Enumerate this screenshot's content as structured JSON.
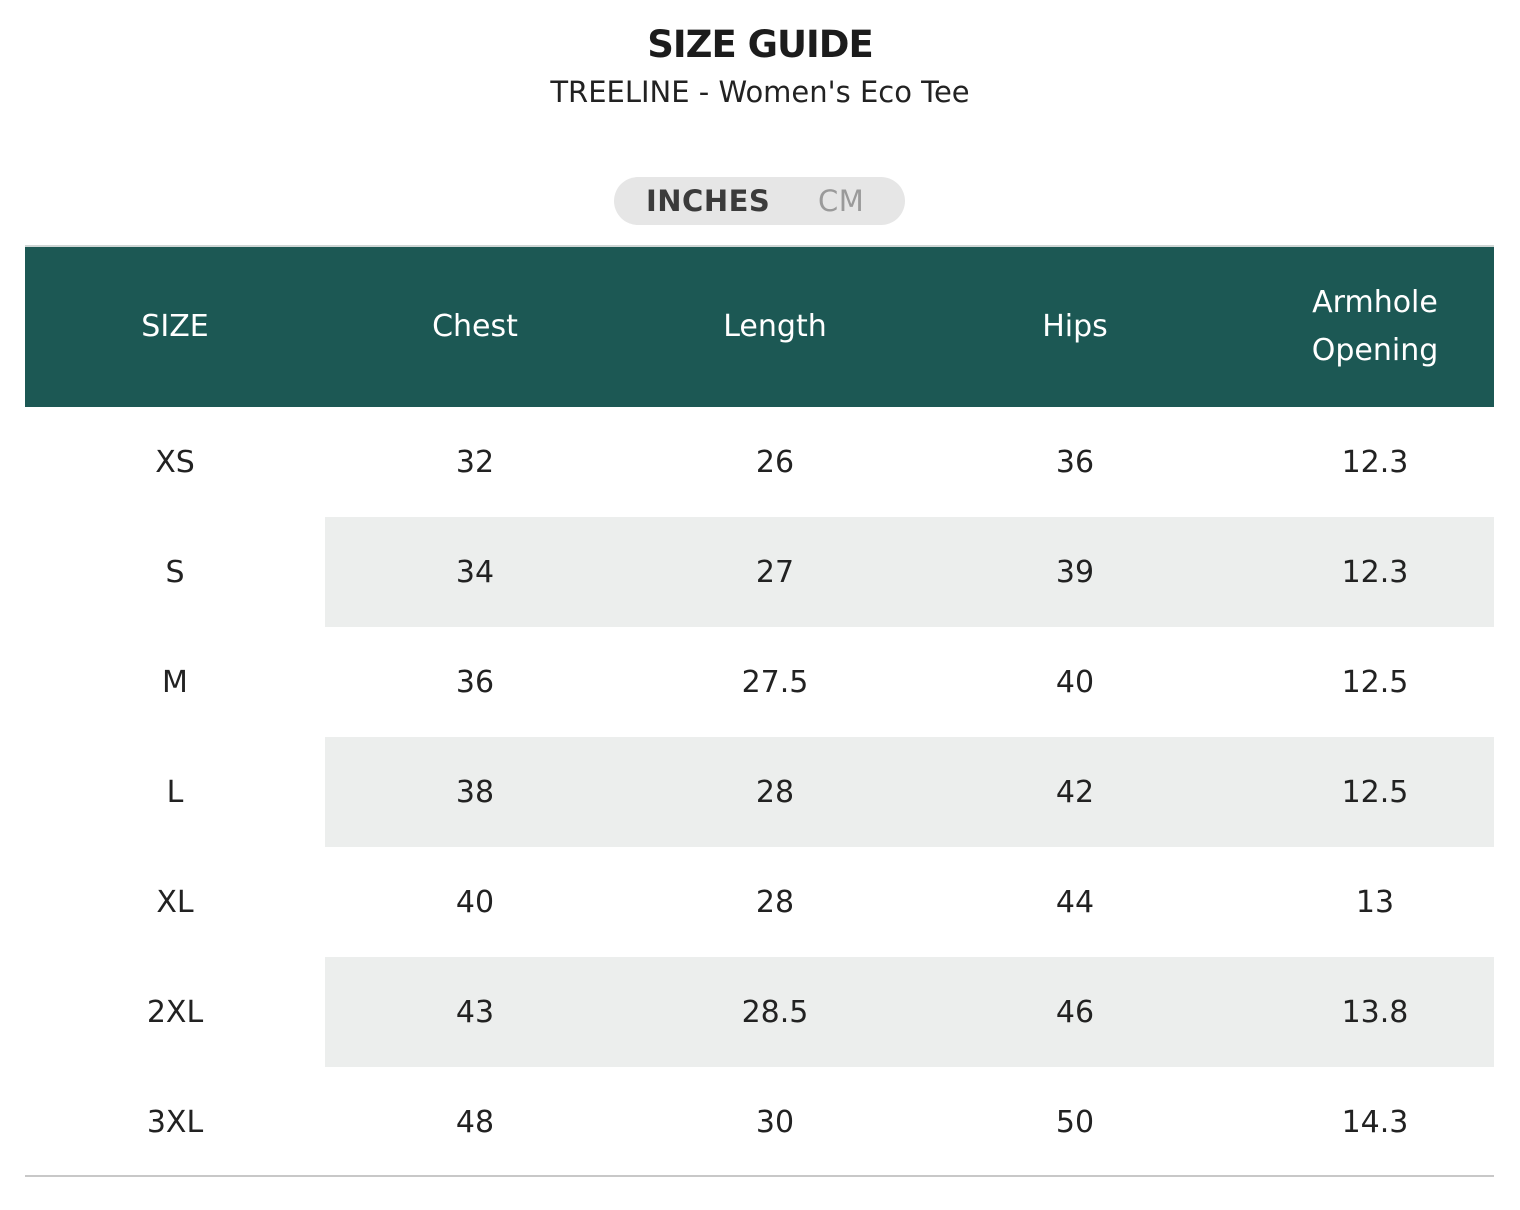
{
  "header": {
    "title": "SIZE GUIDE",
    "subtitle": "TREELINE - Women's Eco Tee"
  },
  "unit_toggle": {
    "options": [
      "INCHES",
      "CM"
    ],
    "selected": "INCHES"
  },
  "table": {
    "columns": [
      "SIZE",
      "Chest",
      "Length",
      "Hips",
      "Armhole\nOpening"
    ],
    "rows": [
      [
        "XS",
        "32",
        "26",
        "36",
        "12.3"
      ],
      [
        "S",
        "34",
        "27",
        "39",
        "12.3"
      ],
      [
        "M",
        "36",
        "27.5",
        "40",
        "12.5"
      ],
      [
        "L",
        "38",
        "28",
        "42",
        "12.5"
      ],
      [
        "XL",
        "40",
        "28",
        "44",
        "13"
      ],
      [
        "2XL",
        "43",
        "28.5",
        "46",
        "13.8"
      ],
      [
        "3XL",
        "48",
        "30",
        "50",
        "14.3"
      ]
    ]
  },
  "colors": {
    "header_bg": "#1c5854",
    "alt_row_bg": "#eceeed",
    "toggle_bg": "#e6e6e6"
  }
}
